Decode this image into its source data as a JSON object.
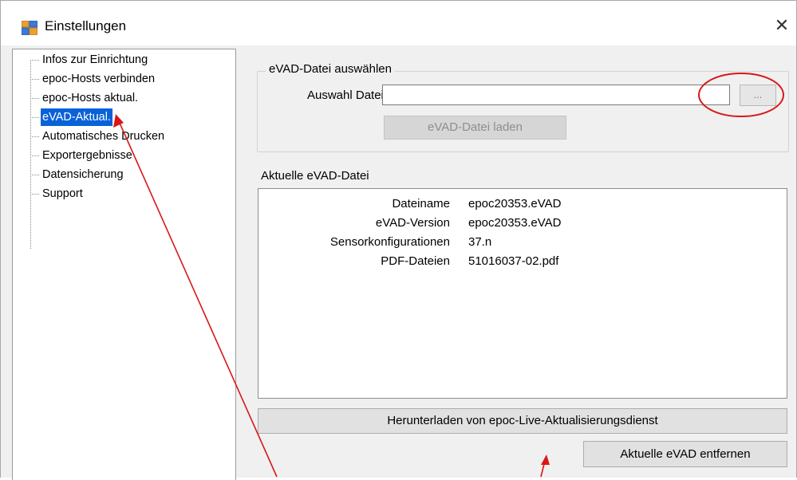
{
  "window": {
    "title": "Einstellungen",
    "close_glyph": "✕"
  },
  "tree": {
    "items": [
      {
        "label": "Infos zur Einrichtung",
        "selected": false
      },
      {
        "label": "epoc-Hosts verbinden",
        "selected": false
      },
      {
        "label": "epoc-Hosts aktual.",
        "selected": false
      },
      {
        "label": "eVAD-Aktual.",
        "selected": true
      },
      {
        "label": "Automatisches Drucken",
        "selected": false
      },
      {
        "label": "Exportergebnisse",
        "selected": false
      },
      {
        "label": "Datensicherung",
        "selected": false
      },
      {
        "label": "Support",
        "selected": false
      }
    ]
  },
  "select_group": {
    "title": "eVAD-Datei auswählen",
    "field_label": "Auswahl Datei",
    "file_value": "",
    "browse_label": "...",
    "load_label": "eVAD-Datei laden"
  },
  "current": {
    "title": "Aktuelle eVAD-Datei",
    "rows": [
      {
        "key": "Dateiname",
        "value": "epoc20353.eVAD"
      },
      {
        "key": "eVAD-Version",
        "value": "epoc20353.eVAD"
      },
      {
        "key": "Sensorkonfigurationen",
        "value": "37.n"
      },
      {
        "key": "PDF-Dateien",
        "value": "51016037-02.pdf"
      }
    ]
  },
  "buttons": {
    "download_label": "Herunterladen von epoc-Live-Aktualisierungsdienst",
    "remove_label": "Aktuelle eVAD entfernen"
  },
  "annotations": {
    "color": "#d81818",
    "icons": [
      "circle-highlight",
      "arrow"
    ]
  }
}
